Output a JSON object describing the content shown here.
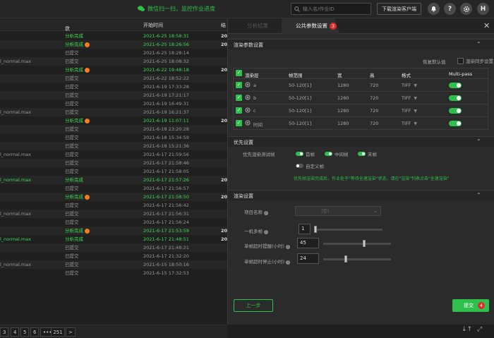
{
  "topbar": {
    "wechat_text": "微信扫一扫，监控作业进度",
    "search_placeholder": "输入名/作业ID",
    "download_label": "下载渲染客户端",
    "help_icon": "?",
    "avatar_letter": "H"
  },
  "table": {
    "headers": {
      "status": "状态",
      "start_time": "开始时间",
      "last": "结"
    },
    "rows": [
      {
        "name": "",
        "status": "分析完成",
        "status_color": "green",
        "warn": false,
        "time": "2021-6-25 18:58:31",
        "time_color": "green",
        "trail": "20"
      },
      {
        "name": "",
        "status": "分析完成",
        "status_color": "green",
        "warn": true,
        "time": "2021-6-25 18:26:56",
        "time_color": "green",
        "trail": "20"
      },
      {
        "name": "",
        "status": "已提交",
        "status_color": "gray",
        "warn": false,
        "time": "2021-6-25 18:28:14",
        "time_color": "gray",
        "trail": ""
      },
      {
        "name": "l_normal.max",
        "status": "已提交",
        "status_color": "gray",
        "warn": false,
        "time": "2021-6-25 18:08:32",
        "time_color": "gray",
        "trail": ""
      },
      {
        "name": "",
        "status": "分析完成",
        "status_color": "green",
        "warn": true,
        "time": "2021-6-22 19:48:18",
        "time_color": "green",
        "trail": "20"
      },
      {
        "name": "",
        "status": "已提交",
        "status_color": "gray",
        "warn": false,
        "time": "2021-6-22 18:52:22",
        "time_color": "gray",
        "trail": ""
      },
      {
        "name": "",
        "status": "已提交",
        "status_color": "gray",
        "warn": false,
        "time": "2021-6-19 17:33:28",
        "time_color": "gray",
        "trail": ""
      },
      {
        "name": "",
        "status": "已提交",
        "status_color": "gray",
        "warn": false,
        "time": "2021-6-19 17:21:17",
        "time_color": "gray",
        "trail": ""
      },
      {
        "name": "",
        "status": "已提交",
        "status_color": "gray",
        "warn": false,
        "time": "2021-6-19 16:49:31",
        "time_color": "gray",
        "trail": ""
      },
      {
        "name": "l_normal.max",
        "status": "已提交",
        "status_color": "gray",
        "warn": false,
        "time": "2021-6-19 16:21:37",
        "time_color": "gray",
        "trail": ""
      },
      {
        "name": "",
        "status": "分析完成",
        "status_color": "green",
        "warn": true,
        "time": "2021-6-19 11:07:11",
        "time_color": "green",
        "trail": "20"
      },
      {
        "name": "",
        "status": "已提交",
        "status_color": "gray",
        "warn": false,
        "time": "2021-6-18 23:20:28",
        "time_color": "gray",
        "trail": ""
      },
      {
        "name": "",
        "status": "已提交",
        "status_color": "gray",
        "warn": false,
        "time": "2021-6-18 15:34:59",
        "time_color": "gray",
        "trail": ""
      },
      {
        "name": "",
        "status": "已提交",
        "status_color": "gray",
        "warn": false,
        "time": "2021-6-18 15:21:36",
        "time_color": "gray",
        "trail": ""
      },
      {
        "name": "l_normal.max",
        "status": "已提交",
        "status_color": "gray",
        "warn": false,
        "time": "2021-6-17 21:59:56",
        "time_color": "gray",
        "trail": ""
      },
      {
        "name": "",
        "status": "已提交",
        "status_color": "gray",
        "warn": false,
        "time": "2021-6-17 21:58:46",
        "time_color": "gray",
        "trail": ""
      },
      {
        "name": "",
        "status": "已提交",
        "status_color": "gray",
        "warn": false,
        "time": "2021-6-17 21:58:05",
        "time_color": "gray",
        "trail": ""
      },
      {
        "name": "l_normal.max",
        "status": "分析完成",
        "status_color": "green",
        "warn": false,
        "time": "2021-6-17 21:57:26",
        "time_color": "green",
        "trail": "20"
      },
      {
        "name": "",
        "status": "已提交",
        "status_color": "gray",
        "warn": false,
        "time": "2021-6-17 21:56:57",
        "time_color": "gray",
        "trail": ""
      },
      {
        "name": "",
        "status": "分析完成",
        "status_color": "green",
        "warn": true,
        "time": "2021-6-17 21:58:50",
        "time_color": "green",
        "trail": "20"
      },
      {
        "name": "",
        "status": "已提交",
        "status_color": "gray",
        "warn": false,
        "time": "2021-6-17 21:56:42",
        "time_color": "gray",
        "trail": ""
      },
      {
        "name": "l_normal.max",
        "status": "已提交",
        "status_color": "gray",
        "warn": false,
        "time": "2021-6-17 21:56:31",
        "time_color": "gray",
        "trail": ""
      },
      {
        "name": "",
        "status": "已提交",
        "status_color": "gray",
        "warn": false,
        "time": "2021-6-17 21:56:24",
        "time_color": "gray",
        "trail": ""
      },
      {
        "name": "",
        "status": "分析完成",
        "status_color": "green",
        "warn": true,
        "time": "2021-6-17 21:53:59",
        "time_color": "green",
        "trail": "20"
      },
      {
        "name": "l_normal.max",
        "status": "分析完成",
        "status_color": "green",
        "warn": false,
        "time": "2021-6-17 21:48:51",
        "time_color": "green",
        "trail": "20"
      },
      {
        "name": "",
        "status": "已提交",
        "status_color": "gray",
        "warn": false,
        "time": "2021-6-17 21:48:21",
        "time_color": "gray",
        "trail": ""
      },
      {
        "name": "",
        "status": "已提交",
        "status_color": "gray",
        "warn": false,
        "time": "2021-6-17 21:32:20",
        "time_color": "gray",
        "trail": ""
      },
      {
        "name": "l_normal.max",
        "status": "已提交",
        "status_color": "gray",
        "warn": false,
        "time": "2021-6-15 18:50:16",
        "time_color": "gray",
        "trail": ""
      },
      {
        "name": "",
        "status": "已提交",
        "status_color": "gray",
        "warn": false,
        "time": "2021-6-15 17:32:53",
        "time_color": "gray",
        "trail": ""
      }
    ]
  },
  "pager": {
    "pages": [
      "3",
      "4",
      "5",
      "6",
      "•••",
      "251"
    ],
    "next": ">"
  },
  "dialog": {
    "tab_inactive": "分析结果",
    "tab_active": "公共参数设置",
    "tab_badge": "3",
    "close": "✕",
    "section_layers": "渲染参数设置",
    "restore_default": "恢复默认值",
    "sync_label": "渲染同步设置",
    "layer_headers": {
      "layer": "渲染层",
      "frames": "帧范围",
      "width": "宽",
      "height": "高",
      "format": "格式",
      "multipass": "Multi-pass"
    },
    "layers": [
      {
        "name": "a",
        "frames": "50-120[1]",
        "width": "1280",
        "height": "720",
        "format": "TIFF"
      },
      {
        "name": "b",
        "frames": "50-120[1]",
        "width": "1280",
        "height": "720",
        "format": "TIFF"
      },
      {
        "name": "c",
        "frames": "50-120[1]",
        "width": "1280",
        "height": "720",
        "format": "TIFF"
      },
      {
        "name": "时间",
        "frames": "50-120[1]",
        "width": "1280",
        "height": "720",
        "format": "TIFF"
      }
    ],
    "section_priority": "优先设置",
    "priority_label": "优先渲染测试帧",
    "priority_options": [
      "首帧",
      "中间帧",
      "末帧"
    ],
    "custom_frames": "自定义帧",
    "priority_hint": "优先帧渲染完成后，作业处于\"等待全速渲染\"状态，请在\"渲染\"列表点击\"全速渲染\"",
    "section_render": "渲染设置",
    "project_name_label": "项目名称",
    "project_name_value": "(空)",
    "machines_label": "一机多帧",
    "machines_value": "1",
    "timeout_warn_label": "单帧超时提醒(小时)",
    "timeout_warn_value": "45",
    "timeout_stop_label": "单帧超时停止(小时)",
    "timeout_stop_value": "24",
    "prev_button": "上一步",
    "submit_button": "提交",
    "submit_badge": "4"
  },
  "colors": {
    "accent": "#2fbf4c",
    "warn": "#f57c1f",
    "badge": "#e02a2a"
  }
}
